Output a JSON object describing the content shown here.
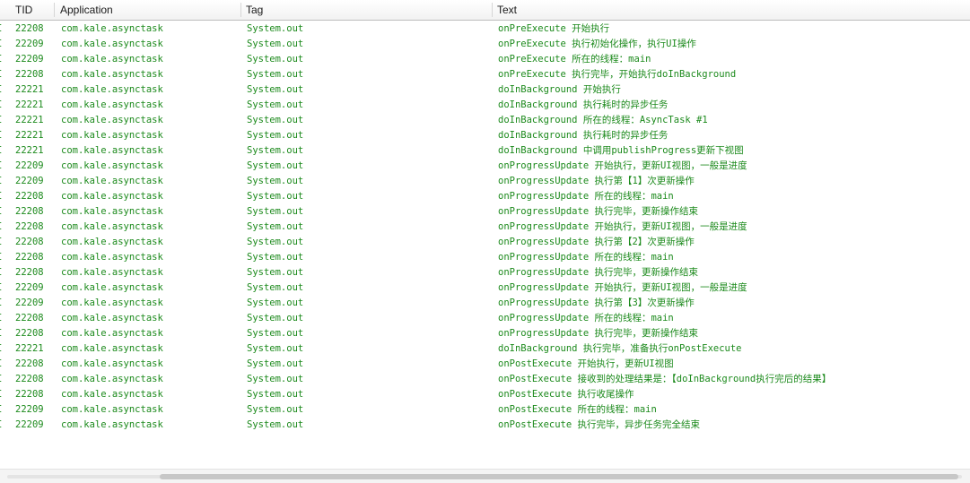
{
  "columns": {
    "tid": "TID",
    "application": "Application",
    "tag": "Tag",
    "text": "Text"
  },
  "colors": {
    "log_text": "#1c8a1c",
    "header_text": "#1a1a1a"
  },
  "rows": [
    {
      "level": "I",
      "tid": "22208",
      "app": "com.kale.asynctask",
      "tag": "System.out",
      "text": "onPreExecute 开始执行"
    },
    {
      "level": "I",
      "tid": "22209",
      "app": "com.kale.asynctask",
      "tag": "System.out",
      "text": "onPreExecute 执行初始化操作，执行UI操作"
    },
    {
      "level": "I",
      "tid": "22209",
      "app": "com.kale.asynctask",
      "tag": "System.out",
      "text": "onPreExecute 所在的线程：main"
    },
    {
      "level": "I",
      "tid": "22208",
      "app": "com.kale.asynctask",
      "tag": "System.out",
      "text": "onPreExecute 执行完毕，开始执行doInBackground"
    },
    {
      "level": "I",
      "tid": "22221",
      "app": "com.kale.asynctask",
      "tag": "System.out",
      "text": "doInBackground 开始执行"
    },
    {
      "level": "I",
      "tid": "22221",
      "app": "com.kale.asynctask",
      "tag": "System.out",
      "text": "doInBackground 执行耗时的异步任务"
    },
    {
      "level": "I",
      "tid": "22221",
      "app": "com.kale.asynctask",
      "tag": "System.out",
      "text": "doInBackground 所在的线程：AsyncTask #1"
    },
    {
      "level": "I",
      "tid": "22221",
      "app": "com.kale.asynctask",
      "tag": "System.out",
      "text": "doInBackground 执行耗时的异步任务"
    },
    {
      "level": "I",
      "tid": "22221",
      "app": "com.kale.asynctask",
      "tag": "System.out",
      "text": "doInBackground 中调用publishProgress更新下视图"
    },
    {
      "level": "I",
      "tid": "22209",
      "app": "com.kale.asynctask",
      "tag": "System.out",
      "text": "onProgressUpdate 开始执行，更新UI视图，一般是进度"
    },
    {
      "level": "I",
      "tid": "22209",
      "app": "com.kale.asynctask",
      "tag": "System.out",
      "text": "onProgressUpdate 执行第【1】次更新操作"
    },
    {
      "level": "I",
      "tid": "22208",
      "app": "com.kale.asynctask",
      "tag": "System.out",
      "text": "onProgressUpdate 所在的线程：main"
    },
    {
      "level": "I",
      "tid": "22208",
      "app": "com.kale.asynctask",
      "tag": "System.out",
      "text": "onProgressUpdate 执行完毕，更新操作结束"
    },
    {
      "level": "I",
      "tid": "22208",
      "app": "com.kale.asynctask",
      "tag": "System.out",
      "text": "onProgressUpdate 开始执行，更新UI视图，一般是进度"
    },
    {
      "level": "I",
      "tid": "22208",
      "app": "com.kale.asynctask",
      "tag": "System.out",
      "text": "onProgressUpdate 执行第【2】次更新操作"
    },
    {
      "level": "I",
      "tid": "22208",
      "app": "com.kale.asynctask",
      "tag": "System.out",
      "text": "onProgressUpdate 所在的线程：main"
    },
    {
      "level": "I",
      "tid": "22208",
      "app": "com.kale.asynctask",
      "tag": "System.out",
      "text": "onProgressUpdate 执行完毕，更新操作结束"
    },
    {
      "level": "I",
      "tid": "22209",
      "app": "com.kale.asynctask",
      "tag": "System.out",
      "text": "onProgressUpdate 开始执行，更新UI视图，一般是进度"
    },
    {
      "level": "I",
      "tid": "22209",
      "app": "com.kale.asynctask",
      "tag": "System.out",
      "text": "onProgressUpdate 执行第【3】次更新操作"
    },
    {
      "level": "I",
      "tid": "22208",
      "app": "com.kale.asynctask",
      "tag": "System.out",
      "text": "onProgressUpdate 所在的线程：main"
    },
    {
      "level": "I",
      "tid": "22208",
      "app": "com.kale.asynctask",
      "tag": "System.out",
      "text": "onProgressUpdate 执行完毕，更新操作结束"
    },
    {
      "level": "I",
      "tid": "22221",
      "app": "com.kale.asynctask",
      "tag": "System.out",
      "text": "doInBackground 执行完毕，准备执行onPostExecute"
    },
    {
      "level": "I",
      "tid": "22208",
      "app": "com.kale.asynctask",
      "tag": "System.out",
      "text": "onPostExecute 开始执行，更新UI视图"
    },
    {
      "level": "I",
      "tid": "22208",
      "app": "com.kale.asynctask",
      "tag": "System.out",
      "text": "onPostExecute 接收到的处理结果是：【doInBackground执行完后的结果】"
    },
    {
      "level": "I",
      "tid": "22208",
      "app": "com.kale.asynctask",
      "tag": "System.out",
      "text": "onPostExecute 执行收尾操作"
    },
    {
      "level": "I",
      "tid": "22209",
      "app": "com.kale.asynctask",
      "tag": "System.out",
      "text": "onPostExecute 所在的线程：main"
    },
    {
      "level": "I",
      "tid": "22209",
      "app": "com.kale.asynctask",
      "tag": "System.out",
      "text": "onPostExecute 执行完毕，异步任务完全结束"
    }
  ]
}
